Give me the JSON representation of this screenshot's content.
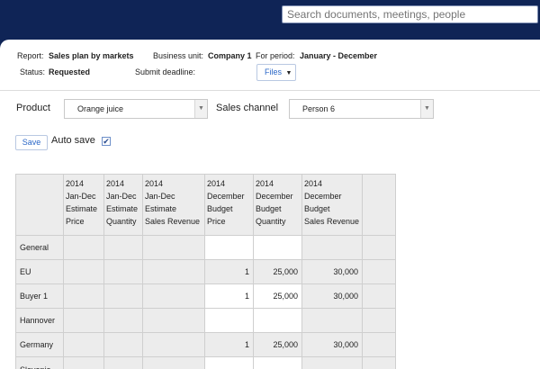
{
  "search": {
    "placeholder": "Search documents, meetings, people"
  },
  "report_info": {
    "report_label": "Report:",
    "report_value": "Sales plan by markets",
    "business_unit_label": "Business unit:",
    "business_unit_value": "Company 1",
    "period_label": "For period:",
    "period_value": "January - December",
    "status_label": "Status:",
    "status_value": "Requested",
    "deadline_label": "Submit deadline:",
    "files_label": "Files"
  },
  "filters": {
    "product_label": "Product",
    "product_value": "Orange juice",
    "channel_label": "Sales channel",
    "channel_value": "Person 6"
  },
  "toolbar": {
    "save_label": "Save",
    "autosave_label": "Auto save",
    "autosave_checked": true
  },
  "grid": {
    "columns": [
      {
        "line1": "2014",
        "line2": "Jan-Dec",
        "line3": "Estimate",
        "line4": "Price"
      },
      {
        "line1": "2014",
        "line2": "Jan-Dec",
        "line3": "Estimate",
        "line4": "Quantity"
      },
      {
        "line1": "2014",
        "line2": "Jan-Dec",
        "line3": "Estimate",
        "line4": "Sales Revenue"
      },
      {
        "line1": "2014",
        "line2": "December",
        "line3": "Budget",
        "line4": "Price"
      },
      {
        "line1": "2014",
        "line2": "December",
        "line3": "Budget",
        "line4": "Quantity"
      },
      {
        "line1": "2014",
        "line2": "December",
        "line3": "Budget",
        "line4": "Sales Revenue"
      }
    ],
    "rows": [
      {
        "label": "General",
        "budget_price": "",
        "budget_quantity": "",
        "budget_revenue": ""
      },
      {
        "label": "EU",
        "budget_price": "1",
        "budget_quantity": "25,000",
        "budget_revenue": "30,000"
      },
      {
        "label": "Buyer 1",
        "budget_price": "1",
        "budget_quantity": "25,000",
        "budget_revenue": "30,000"
      },
      {
        "label": "Hannover",
        "budget_price": "",
        "budget_quantity": "",
        "budget_revenue": ""
      },
      {
        "label": "Germany",
        "budget_price": "1",
        "budget_quantity": "25,000",
        "budget_revenue": "30,000"
      },
      {
        "label": "Slovenia",
        "budget_price": "",
        "budget_quantity": "",
        "budget_revenue": ""
      }
    ]
  }
}
